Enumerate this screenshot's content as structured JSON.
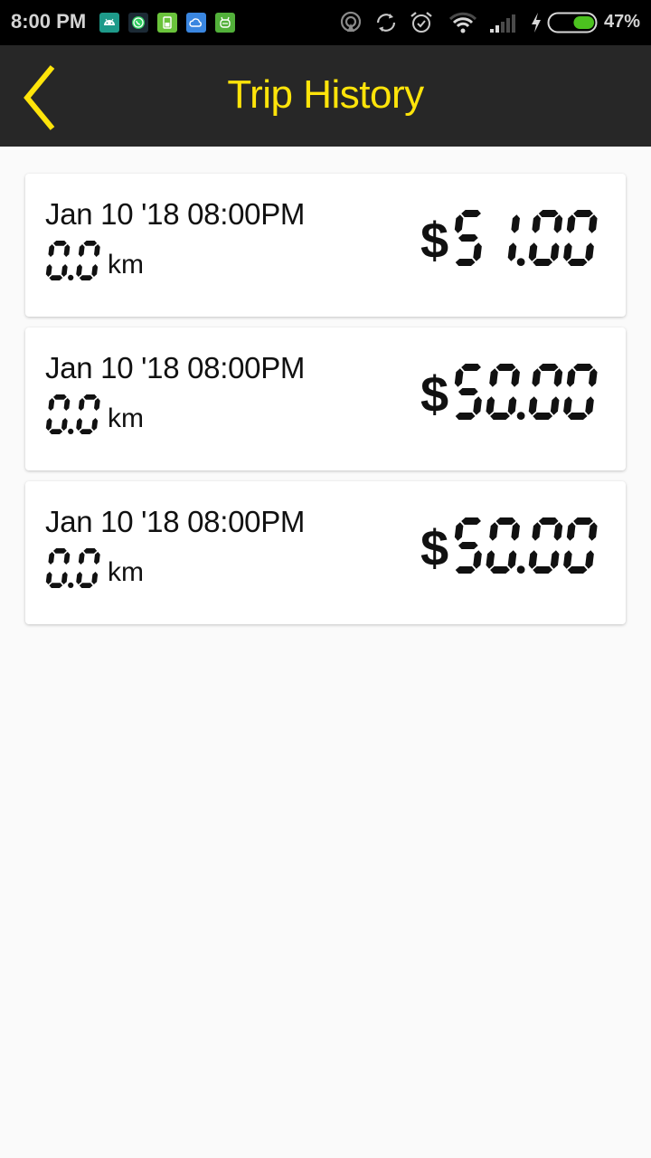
{
  "status_bar": {
    "time": "8:00 PM",
    "notification_icons": [
      "android-debug-icon",
      "whatsapp-icon",
      "sim-card-icon",
      "cloud-icon",
      "app-robot-icon"
    ],
    "system_icons": [
      "hotspot-icon",
      "sync-icon",
      "alarm-icon",
      "wifi-icon",
      "signal-icon",
      "charging-icon",
      "battery-icon"
    ],
    "battery_percent": "47%",
    "battery_level": 0.47,
    "battery_color": "#4cc21f"
  },
  "app_bar": {
    "title": "Trip History",
    "back_icon": "chevron-left-icon",
    "accent_color": "#ffe40a",
    "background_color": "#272727"
  },
  "trips": [
    {
      "date": "Jan 10 '18 08:00PM",
      "distance": "0.0",
      "distance_unit": "km",
      "currency": "$",
      "amount": "51.00"
    },
    {
      "date": "Jan 10 '18 08:00PM",
      "distance": "0.0",
      "distance_unit": "km",
      "currency": "$",
      "amount": "50.00"
    },
    {
      "date": "Jan 10 '18 08:00PM",
      "distance": "0.0",
      "distance_unit": "km",
      "currency": "$",
      "amount": "50.00"
    }
  ]
}
